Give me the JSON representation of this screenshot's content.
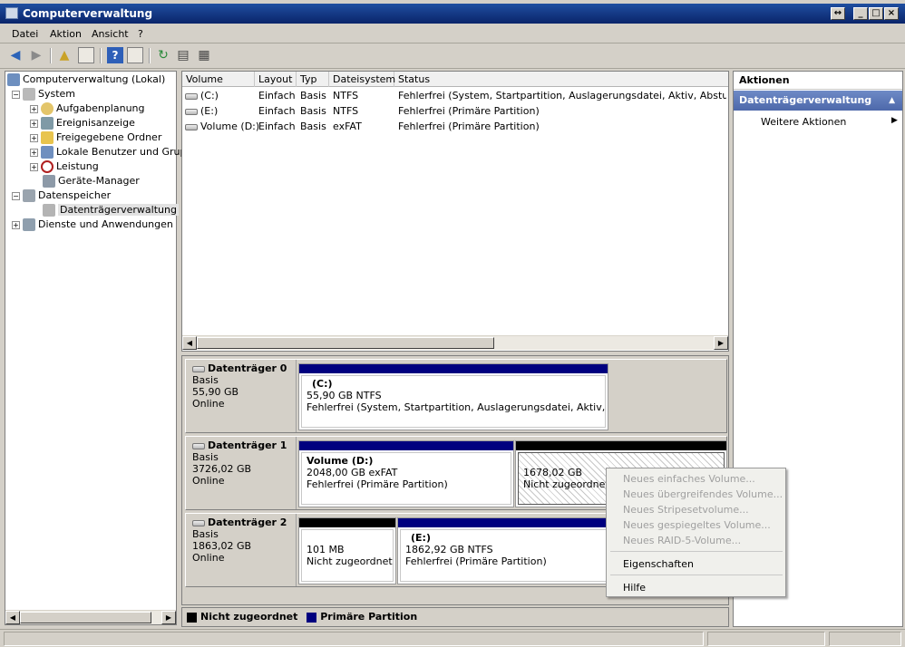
{
  "window": {
    "title": "Computerverwaltung",
    "buttons": [
      "↔",
      "_",
      "□",
      "×"
    ]
  },
  "menu": [
    "Datei",
    "Aktion",
    "Ansicht",
    "?"
  ],
  "tree": {
    "root": "Computerverwaltung (Lokal)",
    "system": "System",
    "system_items": [
      "Aufgabenplanung",
      "Ereignisanzeige",
      "Freigegebene Ordner",
      "Lokale Benutzer und Gruppen",
      "Leistung",
      "Geräte-Manager"
    ],
    "storage": "Datenspeicher",
    "storage_item": "Datenträgerverwaltung",
    "services": "Dienste und Anwendungen"
  },
  "volume_list": {
    "columns": [
      "Volume",
      "Layout",
      "Typ",
      "Dateisystem",
      "Status"
    ],
    "rows": [
      [
        "(C:)",
        "Einfach",
        "Basis",
        "NTFS",
        "Fehlerfrei (System, Startpartition, Auslagerungsdatei, Aktiv, Absturzabbild,"
      ],
      [
        "(E:)",
        "Einfach",
        "Basis",
        "NTFS",
        "Fehlerfrei (Primäre Partition)"
      ],
      [
        "Volume (D:)",
        "Einfach",
        "Basis",
        "exFAT",
        "Fehlerfrei (Primäre Partition)"
      ]
    ]
  },
  "disks": [
    {
      "name": "Datenträger 0",
      "type": "Basis",
      "size": "55,90 GB",
      "state": "Online",
      "parts": [
        {
          "title": "(C:)",
          "line1": "55,90 GB NTFS",
          "line2": "Fehlerfrei (System, Startpartition, Auslagerungsdatei, Aktiv, Absturzabbild, Primäre Partition)"
        }
      ]
    },
    {
      "name": "Datenträger 1",
      "type": "Basis",
      "size": "3726,02 GB",
      "state": "Online",
      "parts": [
        {
          "title": "Volume  (D:)",
          "line1": "2048,00 GB exFAT",
          "line2": "Fehlerfrei (Primäre Partition)"
        },
        {
          "title": "",
          "line1": "1678,02 GB",
          "line2": "Nicht zugeordnet"
        }
      ]
    },
    {
      "name": "Datenträger 2",
      "type": "Basis",
      "size": "1863,02 GB",
      "state": "Online",
      "parts": [
        {
          "title": "",
          "line1": "101 MB",
          "line2": "Nicht zugeordnet"
        },
        {
          "title": "(E:)",
          "line1": "1862,92 GB NTFS",
          "line2": "Fehlerfrei (Primäre Partition)"
        }
      ]
    }
  ],
  "legend": {
    "unallocated": "Nicht zugeordnet",
    "primary": "Primäre Partition",
    "unallocated_color": "#000000",
    "primary_color": "#00007f"
  },
  "actions": {
    "title": "Aktionen",
    "section": "Datenträgerverwaltung",
    "more": "Weitere Aktionen"
  },
  "context_menu": {
    "disabled": [
      "Neues einfaches Volume...",
      "Neues übergreifendes Volume...",
      "Neues Stripesetvolume...",
      "Neues gespiegeltes Volume...",
      "Neues RAID-5-Volume..."
    ],
    "properties": "Eigenschaften",
    "help": "Hilfe"
  },
  "icons": {
    "back": "back-arrow-icon",
    "forward": "forward-arrow-icon",
    "up": "up-folder-icon",
    "help": "help-icon",
    "refresh": "refresh-icon"
  }
}
